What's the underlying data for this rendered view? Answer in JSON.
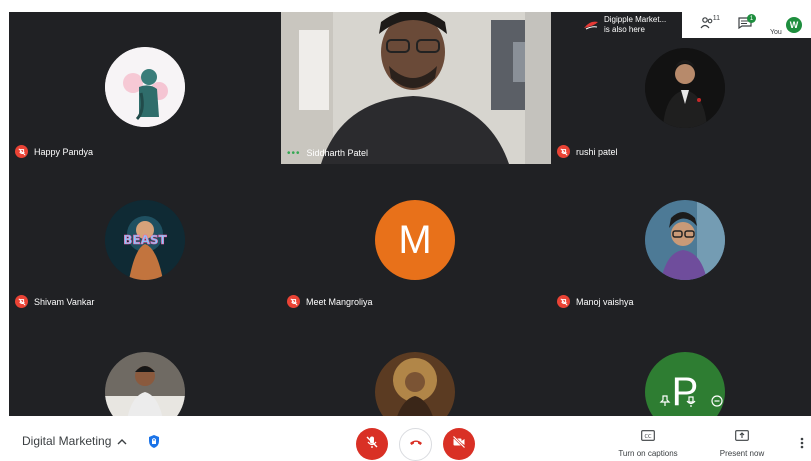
{
  "tiles": [
    {
      "name": "Happy Pandya",
      "muted": true
    },
    {
      "name": "Siddharth Patel",
      "speaking": true
    },
    {
      "name": "rushi patel",
      "muted": true
    },
    {
      "name": "Shivam Vankar",
      "muted": true
    },
    {
      "name": "Meet Mangroliya",
      "muted": true,
      "initial": "M"
    },
    {
      "name": "Manoj vaishya",
      "muted": true
    },
    {
      "name": ""
    },
    {
      "name": ""
    },
    {
      "name": "",
      "initial": "P"
    }
  ],
  "avatar_text": {
    "beast": "BEAST"
  },
  "topbar": {
    "notice_line1": "Digipple Market...",
    "notice_line2": "is also here",
    "people_badge": "11",
    "chat_badge": "1",
    "you_label": "You",
    "self_initial": "W"
  },
  "bottombar": {
    "meeting_title": "Digital Marketing",
    "captions_label": "Turn on captions",
    "present_label": "Present now"
  },
  "colors": {
    "tile_bg": "#202124",
    "accent_red": "#ea4335",
    "meet_avatar": "#e8711a",
    "p_avatar": "#2e7d32",
    "self_avatar": "#1e8e3e",
    "speaking_dots": "#34a853"
  }
}
